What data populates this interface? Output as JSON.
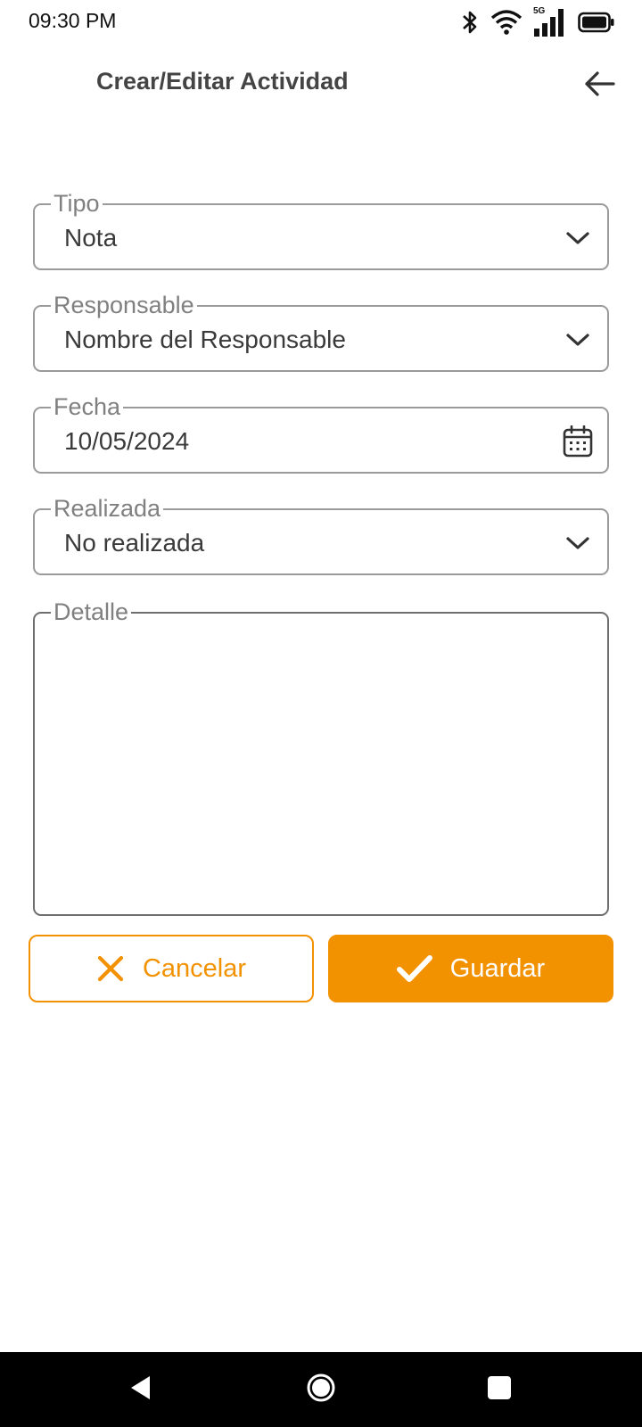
{
  "status_bar": {
    "time": "09:30 PM",
    "network_label": "5G",
    "icons": [
      "bluetooth-icon",
      "wifi-icon",
      "signal-5g-icon",
      "battery-icon"
    ]
  },
  "header": {
    "title": "Crear/Editar Actividad",
    "back_icon": "arrow-left-icon"
  },
  "form": {
    "tipo": {
      "label": "Tipo",
      "value": "Nota",
      "icon": "chevron-down-icon"
    },
    "responsable": {
      "label": "Responsable",
      "value": "Nombre del Responsable",
      "icon": "chevron-down-icon"
    },
    "fecha": {
      "label": "Fecha",
      "value": "10/05/2024",
      "icon": "calendar-icon"
    },
    "realizada": {
      "label": "Realizada",
      "value": "No realizada",
      "icon": "chevron-down-icon"
    },
    "detalle": {
      "label": "Detalle",
      "value": ""
    }
  },
  "actions": {
    "cancel_label": "Cancelar",
    "cancel_icon": "close-icon",
    "save_label": "Guardar",
    "save_icon": "check-icon"
  },
  "colors": {
    "accent": "#f39200",
    "border": "#9a9a9a",
    "label": "#808080",
    "nav_bar": "#000000"
  },
  "nav_bar": {
    "icons": [
      "nav-back-icon",
      "nav-home-icon",
      "nav-recents-icon"
    ]
  }
}
